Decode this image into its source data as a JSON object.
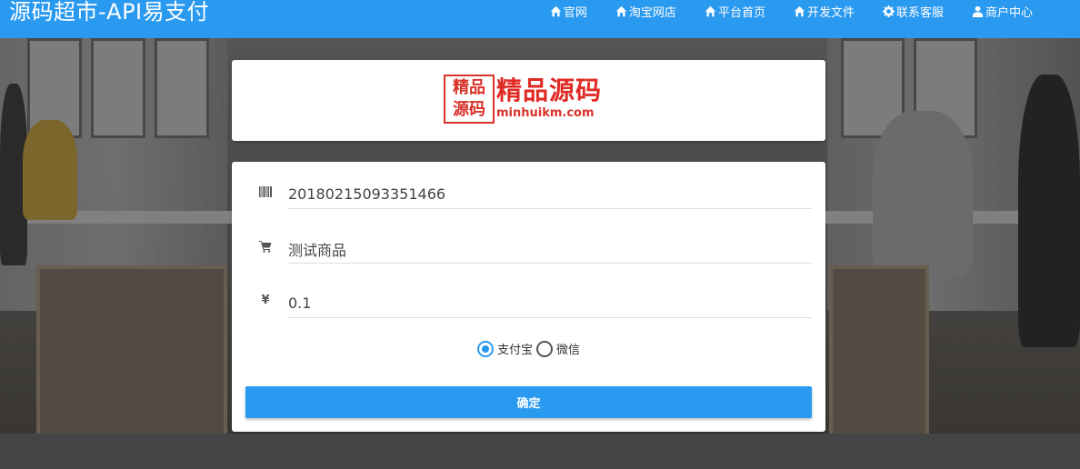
{
  "brand": "源码超市-API易支付",
  "nav": [
    {
      "label": "官网",
      "icon": "home-icon"
    },
    {
      "label": "淘宝网店",
      "icon": "home-icon"
    },
    {
      "label": "平台首页",
      "icon": "home-icon"
    },
    {
      "label": "开发文件",
      "icon": "home-icon"
    },
    {
      "label": "联系客服",
      "icon": "gear-icon"
    },
    {
      "label": "商户中心",
      "icon": "user-icon"
    }
  ],
  "logo": {
    "stamp_line1": "精品",
    "stamp_line2": "源码",
    "title": "精品源码",
    "url": "minhuikm.com"
  },
  "form": {
    "order_no": "20180215093351466",
    "product_name": "测试商品",
    "amount": "0.1",
    "currency_symbol": "¥",
    "payment_options": [
      {
        "label": "支付宝",
        "checked": true
      },
      {
        "label": "微信",
        "checked": false
      }
    ],
    "submit_label": "确定"
  },
  "colors": {
    "primary": "#2a99f0",
    "logo_red": "#e02a24"
  }
}
